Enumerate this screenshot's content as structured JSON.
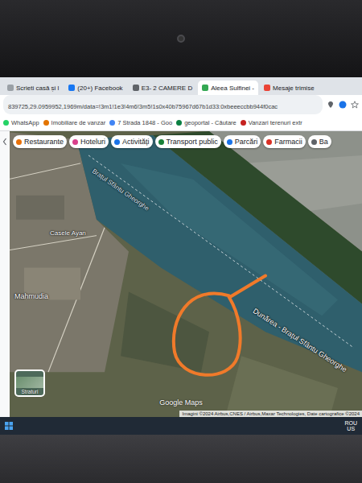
{
  "browser": {
    "tabs": [
      {
        "label": "Scrieti casă și l",
        "selected": false
      },
      {
        "label": "(20+) Facebook",
        "selected": false
      },
      {
        "label": "E3- 2 CAMERE D",
        "selected": false
      },
      {
        "label": "Aleea Sulfinei - ",
        "selected": true
      },
      {
        "label": "Mesaje trimise",
        "selected": false
      }
    ],
    "url": "839725,29.0959952,1969m/data=!3m1!1e3!4m6!3m5!1s0x40b75967d67b1d33:0xbeeeccbb944f0cac",
    "bookmarks": [
      {
        "label": "WhatsApp"
      },
      {
        "label": "Imobiliare de vanzar"
      },
      {
        "label": "7 Strada 1848 - Goo"
      },
      {
        "label": "geoportal - Căutare"
      },
      {
        "label": "Vanzari terenuri extr"
      }
    ]
  },
  "map": {
    "chips": [
      {
        "label": "Restaurante"
      },
      {
        "label": "Hoteluri"
      },
      {
        "label": "Activități"
      },
      {
        "label": "Transport public"
      },
      {
        "label": "Parcări"
      },
      {
        "label": "Farmacii"
      },
      {
        "label": "Ba"
      }
    ],
    "places": {
      "neighborhood": "Casele Ayan",
      "town": "Mahmudia"
    },
    "river_labels": {
      "upper": "Brațul Sfântu Gheorghe",
      "lower": "Dunărea - Brațul Sfântu Gheorghe"
    },
    "layers_button": "Straturi",
    "logo": "Google Maps",
    "attribution": "Imagini ©2024 Airbus,CNES / Airbus,Maxar Technologies, Date cartografice ©2024",
    "annotation": {
      "color": "#f07a2a"
    }
  },
  "taskbar": {
    "language": "ROU",
    "layout": "US"
  }
}
